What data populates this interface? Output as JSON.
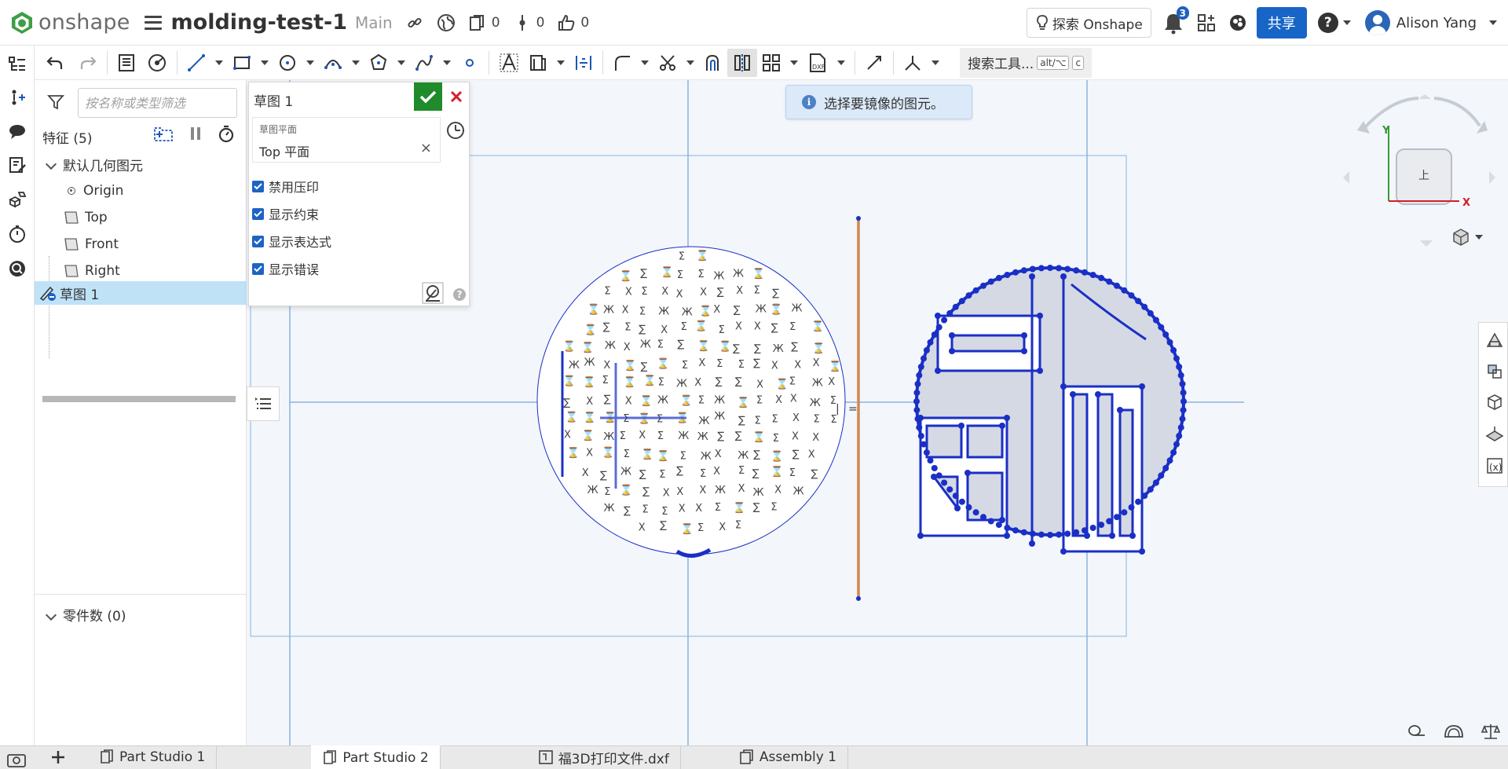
{
  "app": {
    "brand": "onshape",
    "document_name": "molding-test-1",
    "branch": "Main",
    "copies_count": "0",
    "versions_count": "0",
    "likes_count": "0"
  },
  "header": {
    "explore_label": "探索 Onshape",
    "notifications_count": "3",
    "share_label": "共享",
    "help_label": "?",
    "user_name": "Alison Yang"
  },
  "toolbar": {
    "search_tools_label": "搜索工具...",
    "shortcut_keys": [
      "alt/⌥",
      "c"
    ]
  },
  "feature_panel": {
    "filter_placeholder": "按名称或类型筛选",
    "features_header": "特征 (5)",
    "default_geometry_label": "默认几何图元",
    "items": [
      {
        "label": "Origin",
        "type": "origin"
      },
      {
        "label": "Top",
        "type": "plane"
      },
      {
        "label": "Front",
        "type": "plane"
      },
      {
        "label": "Right",
        "type": "plane"
      }
    ],
    "sketch_label": "草图 1",
    "parts_header": "零件数 (0)"
  },
  "sketch_dialog": {
    "title": "草图 1",
    "plane_label": "草图平面",
    "plane_value": "Top 平面",
    "clear_label": "×",
    "checkboxes": [
      {
        "label": "禁用压印",
        "checked": true
      },
      {
        "label": "显示约束",
        "checked": true
      },
      {
        "label": "显示表达式",
        "checked": true
      },
      {
        "label": "显示错误",
        "checked": true
      }
    ],
    "help_label": "?"
  },
  "toast": {
    "message": "选择要镜像的图元。"
  },
  "view_cube": {
    "face_label": "上",
    "axis_y": "Y",
    "axis_x": "X"
  },
  "tabs": [
    {
      "label": "Part Studio 1",
      "active": false
    },
    {
      "label": "Part Studio 2",
      "active": true
    },
    {
      "label": "福3D打印文件.dxf",
      "active": false
    },
    {
      "label": "Assembly 1",
      "active": false
    }
  ],
  "colors": {
    "accent": "#1765c6",
    "ok_green": "#1f8b2a",
    "cancel_red": "#d0202a",
    "sketch_blue": "#1a2fc6",
    "mirror_line": "#d2874f",
    "selection": "#bfe2f7"
  }
}
